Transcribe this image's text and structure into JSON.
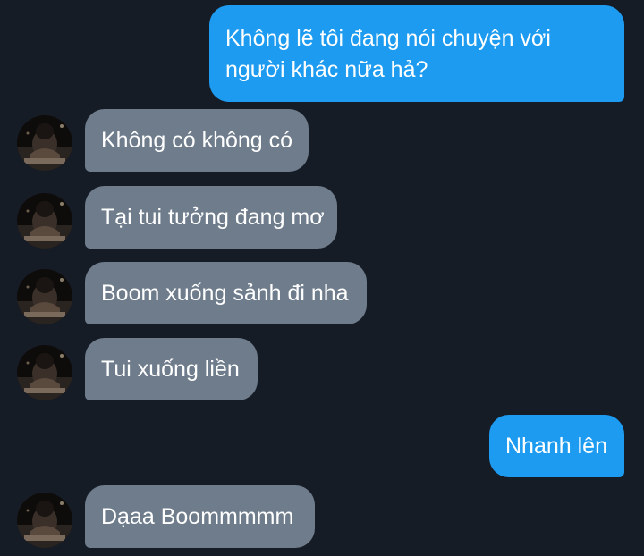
{
  "colors": {
    "background": "#161c26",
    "sent_bubble": "#1d9bf0",
    "received_bubble": "#6e7c8c",
    "text": "#ffffff"
  },
  "messages": [
    {
      "direction": "sent",
      "text_lines": [
        "Không lẽ tôi đang nói chuyện với",
        "người khác nữa hả?"
      ]
    },
    {
      "direction": "received",
      "text": "Không có không có"
    },
    {
      "direction": "received",
      "text": "Tại tui tưởng đang mơ"
    },
    {
      "direction": "received",
      "text": "Boom xuống sảnh đi nha"
    },
    {
      "direction": "received",
      "text": "Tui xuống liền"
    },
    {
      "direction": "sent",
      "text": "Nhanh lên"
    },
    {
      "direction": "received",
      "text": "Dạaa Boommmmm"
    }
  ]
}
